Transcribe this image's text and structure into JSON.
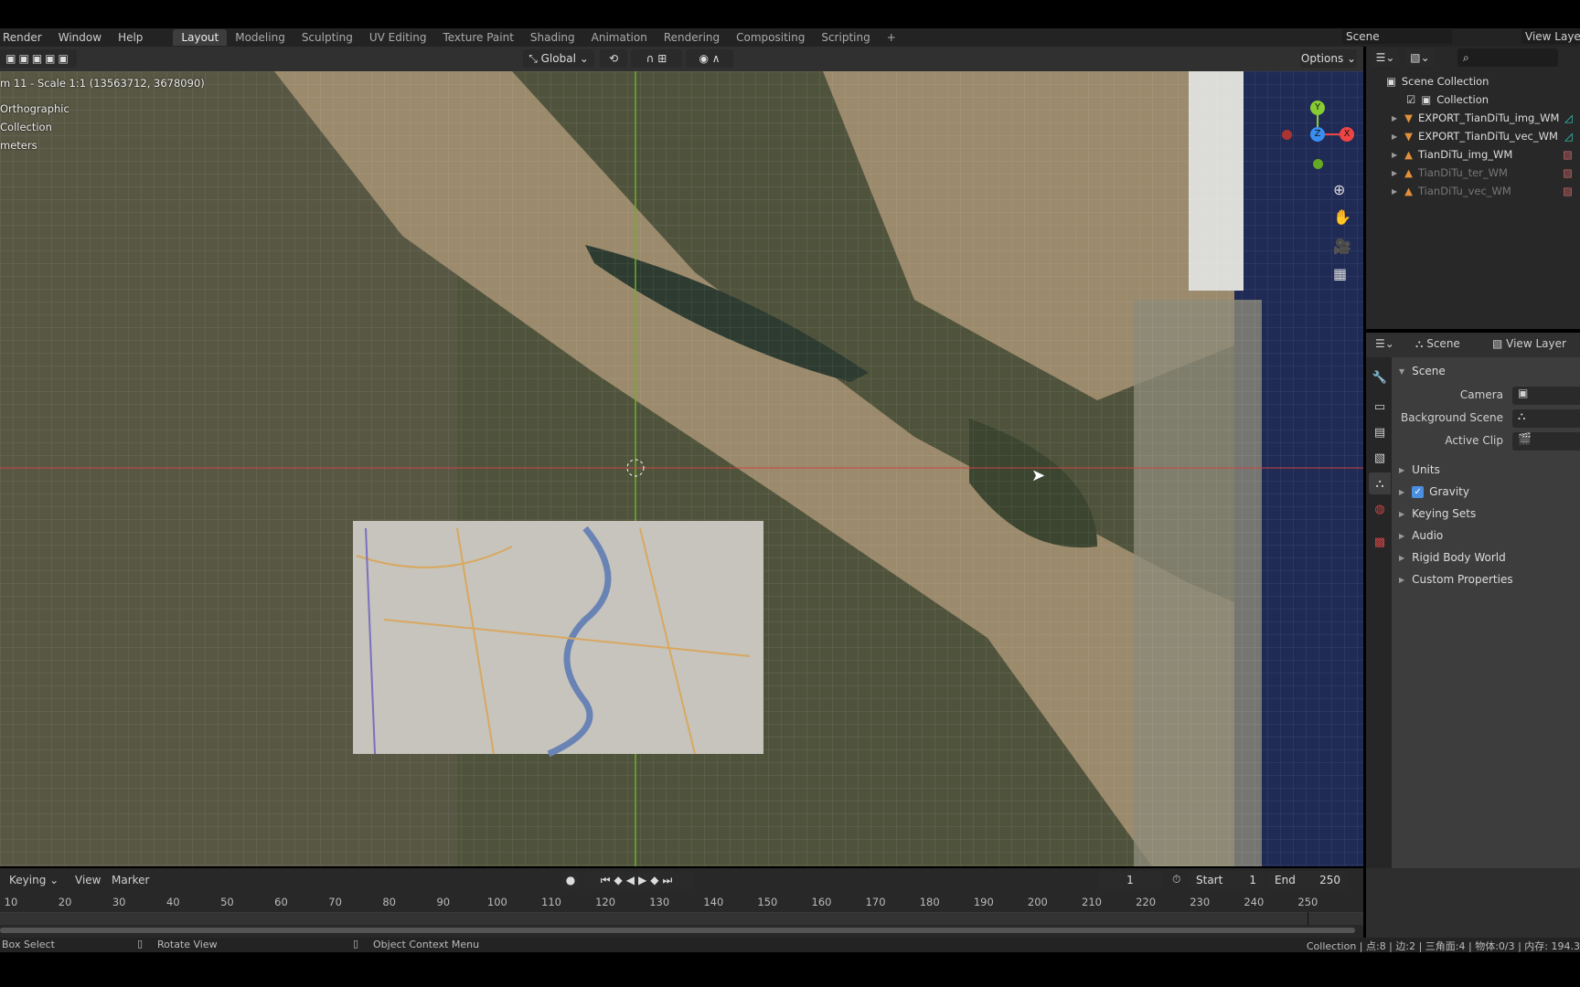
{
  "menu": [
    "Render",
    "Window",
    "Help"
  ],
  "workspaces": [
    {
      "label": "Layout",
      "active": true
    },
    {
      "label": "Modeling"
    },
    {
      "label": "Sculpting"
    },
    {
      "label": "UV Editing"
    },
    {
      "label": "Texture Paint"
    },
    {
      "label": "Shading"
    },
    {
      "label": "Animation"
    },
    {
      "label": "Rendering"
    },
    {
      "label": "Compositing"
    },
    {
      "label": "Scripting"
    },
    {
      "label": "+"
    }
  ],
  "scene_field": "Scene",
  "view_layer_field": "View Layer",
  "header": {
    "orientation": "Global",
    "options": "Options"
  },
  "viewport": {
    "info": [
      "m 11 - Scale 1:1 (13563712, 3678090)",
      "Orthographic",
      "Collection",
      "meters"
    ],
    "gizmo": {
      "x": "X",
      "y": "Y",
      "z": "Z"
    }
  },
  "outliner": {
    "root": "Scene Collection",
    "collection": "Collection",
    "items": [
      {
        "label": "EXPORT_TianDiTu_img_WM",
        "type": "mesh",
        "dim": false
      },
      {
        "label": "EXPORT_TianDiTu_vec_WM",
        "type": "mesh",
        "dim": false
      },
      {
        "label": "TianDiTu_img_WM",
        "type": "image",
        "dim": false
      },
      {
        "label": "TianDiTu_ter_WM",
        "type": "image",
        "dim": true
      },
      {
        "label": "TianDiTu_vec_WM",
        "type": "image",
        "dim": true
      }
    ]
  },
  "properties": {
    "tabs": [
      "Scene",
      "View Layer"
    ],
    "section": "Scene",
    "fields": [
      {
        "label": "Camera"
      },
      {
        "label": "Background Scene"
      },
      {
        "label": "Active Clip"
      }
    ],
    "panels": [
      {
        "label": "Units"
      },
      {
        "label": "Gravity",
        "checked": true
      },
      {
        "label": "Keying Sets"
      },
      {
        "label": "Audio"
      },
      {
        "label": "Rigid Body World"
      },
      {
        "label": "Custom Properties"
      }
    ]
  },
  "timeline": {
    "menus": [
      "Keying",
      "View",
      "Marker"
    ],
    "current_frame": "1",
    "start_label": "Start",
    "start": "1",
    "end_label": "End",
    "end": "250",
    "ticks": [
      "10",
      "20",
      "30",
      "40",
      "50",
      "60",
      "70",
      "80",
      "90",
      "100",
      "110",
      "120",
      "130",
      "140",
      "150",
      "160",
      "170",
      "180",
      "190",
      "200",
      "210",
      "220",
      "230",
      "240",
      "250"
    ]
  },
  "status": {
    "left": [
      "Box Select",
      "Rotate View",
      "Object Context Menu"
    ],
    "right": "Collection | 点:8 | 边:2 | 三角面:4 | 物体:0/3  | 内存: 194.3"
  }
}
